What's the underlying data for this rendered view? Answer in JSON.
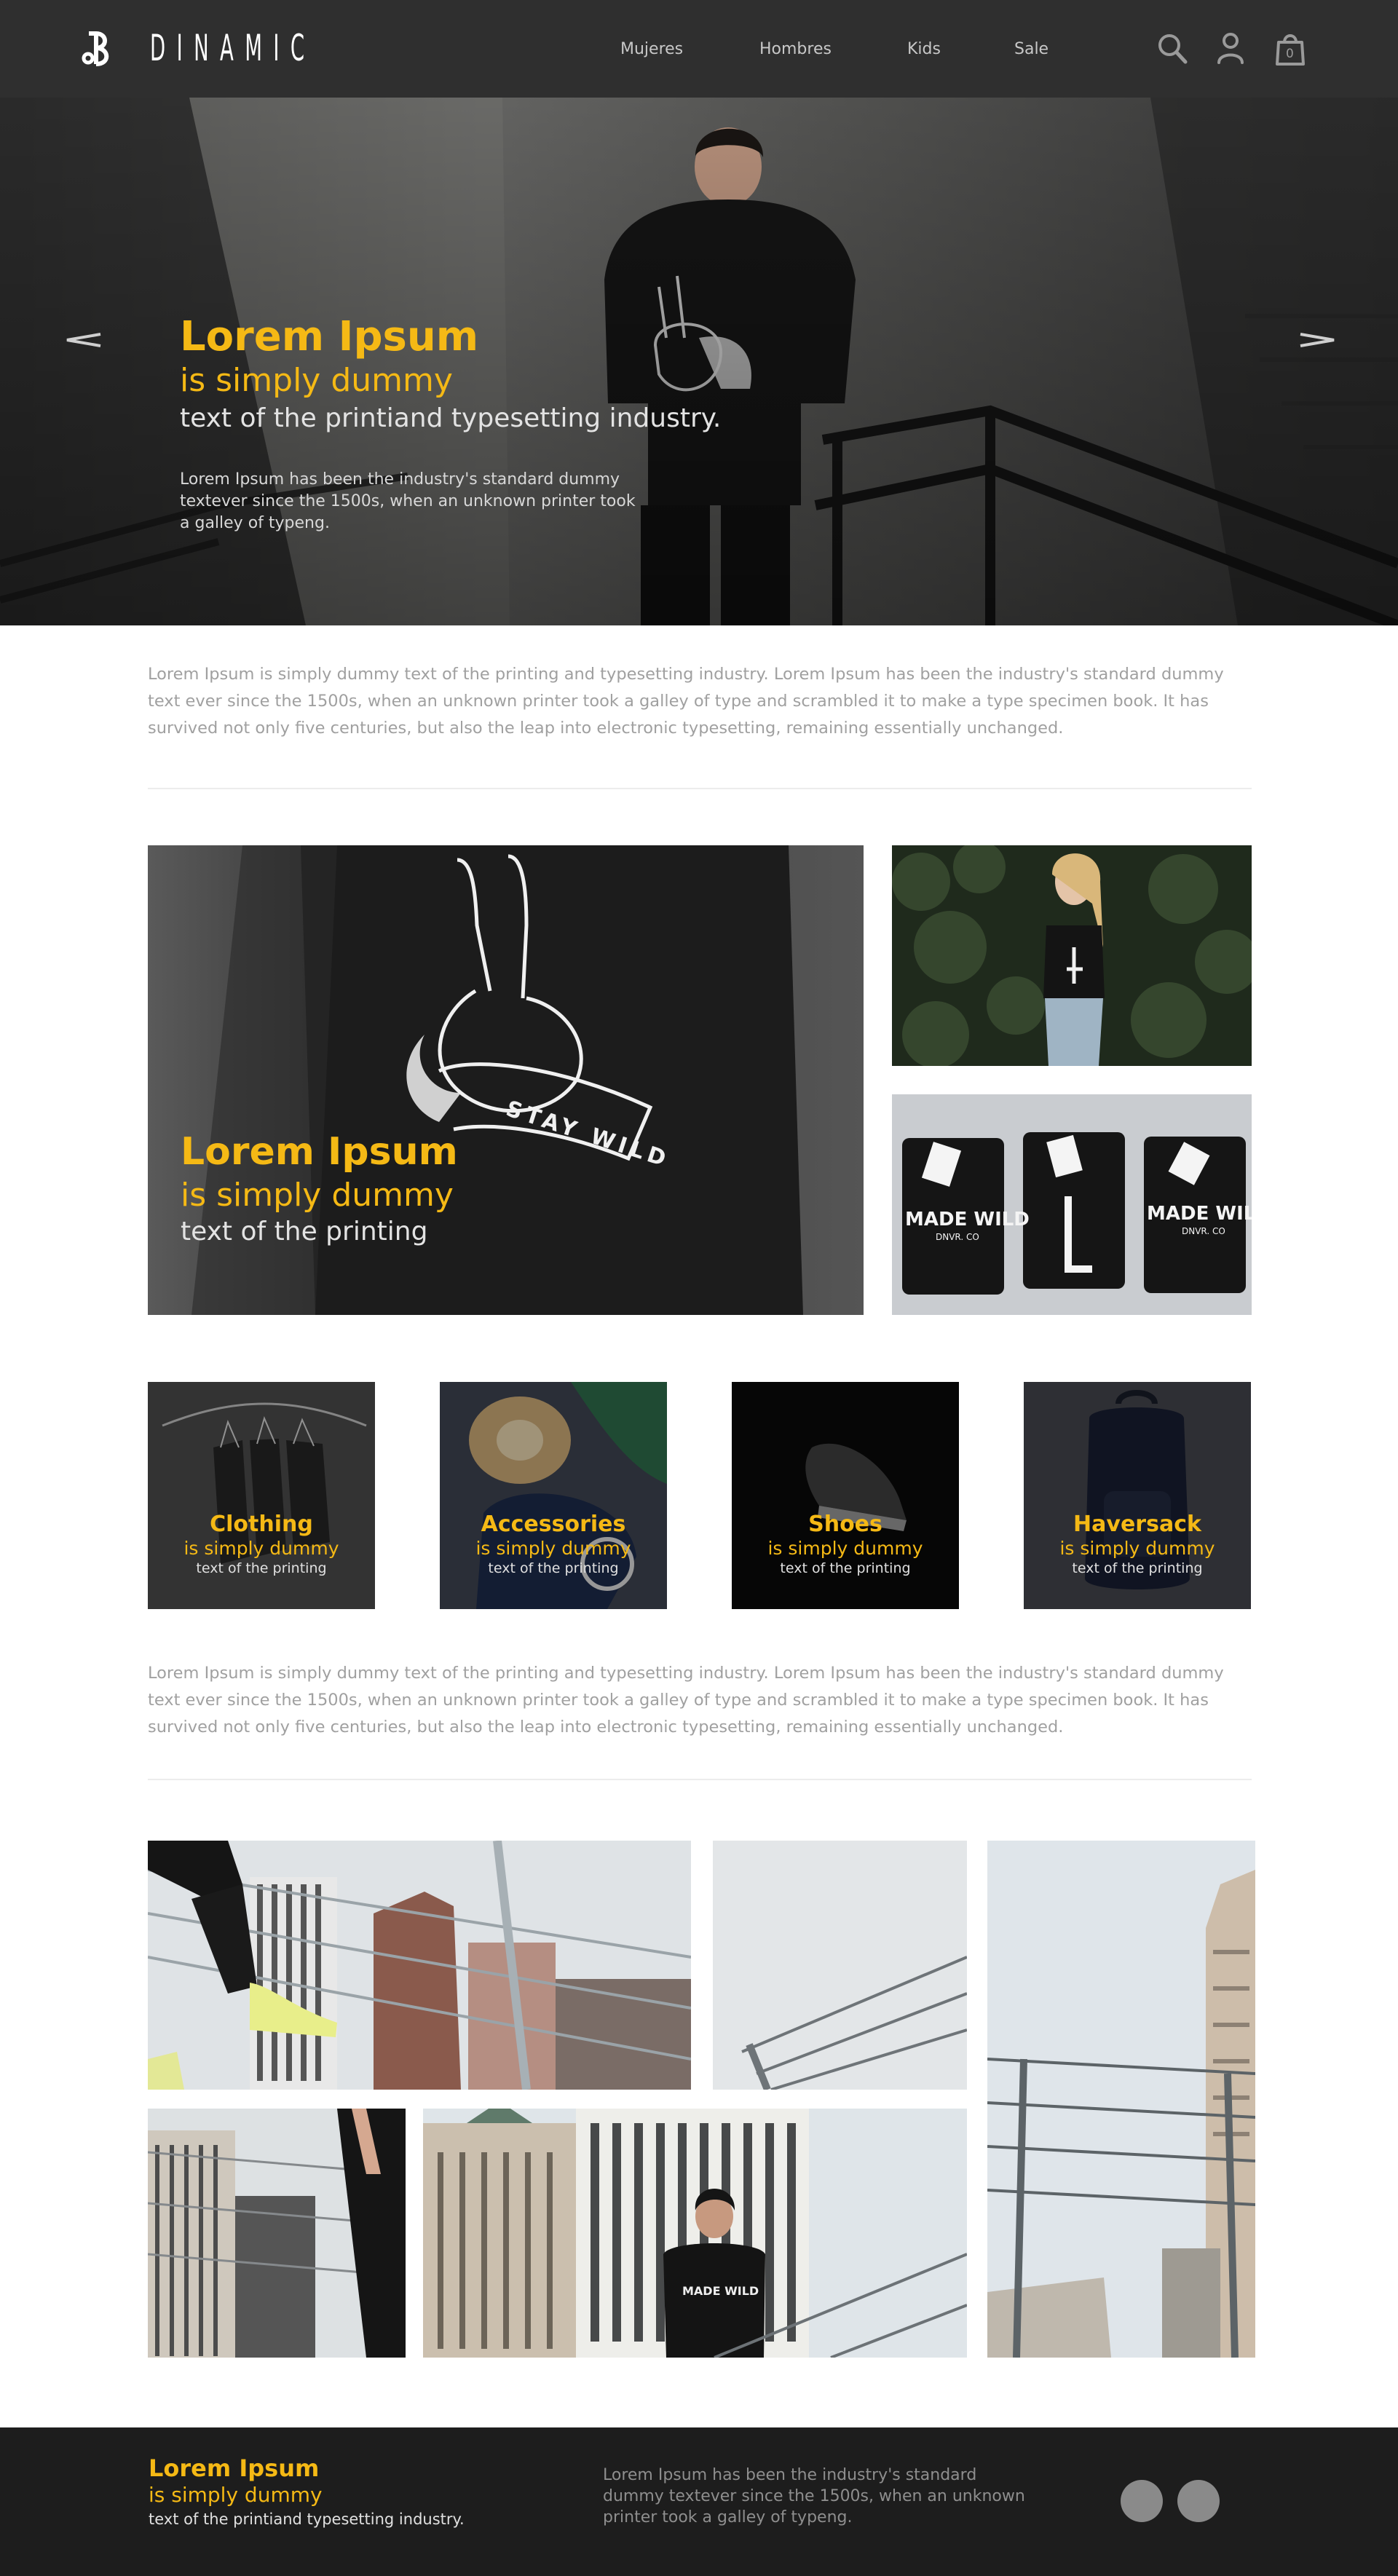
{
  "header": {
    "logo_text": "DINAMIC",
    "nav": [
      "Mujeres",
      "Hombres",
      "Kids",
      "Sale"
    ],
    "icons": [
      "search-icon",
      "user-icon",
      "shopping-bag-icon"
    ],
    "cart_count": "0"
  },
  "hero": {
    "title": "Lorem Ipsum",
    "subtitle": "is simply dummy",
    "subtitle2": "text of the printiand typesetting industry.",
    "body": "Lorem Ipsum has been the industry's standard dummy textever since the 1500s, when an unknown printer took a galley of typeng.",
    "icons": [
      "arrow-left-icon",
      "arrow-right-icon"
    ]
  },
  "intro": {
    "text": "Lorem Ipsum is simply dummy text of the printing and typesetting industry. Lorem Ipsum has been the industry's standard dummy text ever since the 1500s, when an unknown printer took a galley of type and scrambled it to make a type specimen book. It has survived not only five centuries, but also the leap into electronic typesetting, remaining essentially unchanged."
  },
  "feature": {
    "title": "Lorem Ipsum",
    "subtitle": "is simply dummy",
    "subtitle2": "text of the printing",
    "shirt_print": "STAY WILD",
    "shirt_brand": "MADE WILD",
    "shirt_sub": "DNVR. CO"
  },
  "categories": [
    {
      "title": "Clothing",
      "subtitle": "is simply dummy",
      "subtitle2": "text of the printing"
    },
    {
      "title": "Accessories",
      "subtitle": "is simply dummy",
      "subtitle2": "text of the printing"
    },
    {
      "title": "Shoes",
      "subtitle": "is simply dummy",
      "subtitle2": "text of the printing"
    },
    {
      "title": "Haversack",
      "subtitle": "is simply dummy",
      "subtitle2": "text of the printing"
    }
  ],
  "second_para": {
    "text": "Lorem Ipsum is simply dummy text of the printing and typesetting industry. Lorem Ipsum has been the industry's standard dummy text ever since the 1500s, when an unknown printer took a galley of type and scrambled it to make a type specimen book. It has survived not only five centuries, but also the leap into electronic typesetting, remaining essentially unchanged."
  },
  "gallery": {
    "tee_text": "MADE WILD"
  },
  "footer": {
    "title": "Lorem Ipsum",
    "subtitle": "is simply dummy",
    "subtitle2": "text of the printiand typesetting industry.",
    "body": "Lorem Ipsum has been the industry's standard dummy textever since the 1500s, when an unknown printer took a galley of typeng."
  },
  "colors": {
    "accent": "#f5b915",
    "header_bg": "#2f2f2f",
    "footer_bg": "#1d1d1d"
  }
}
